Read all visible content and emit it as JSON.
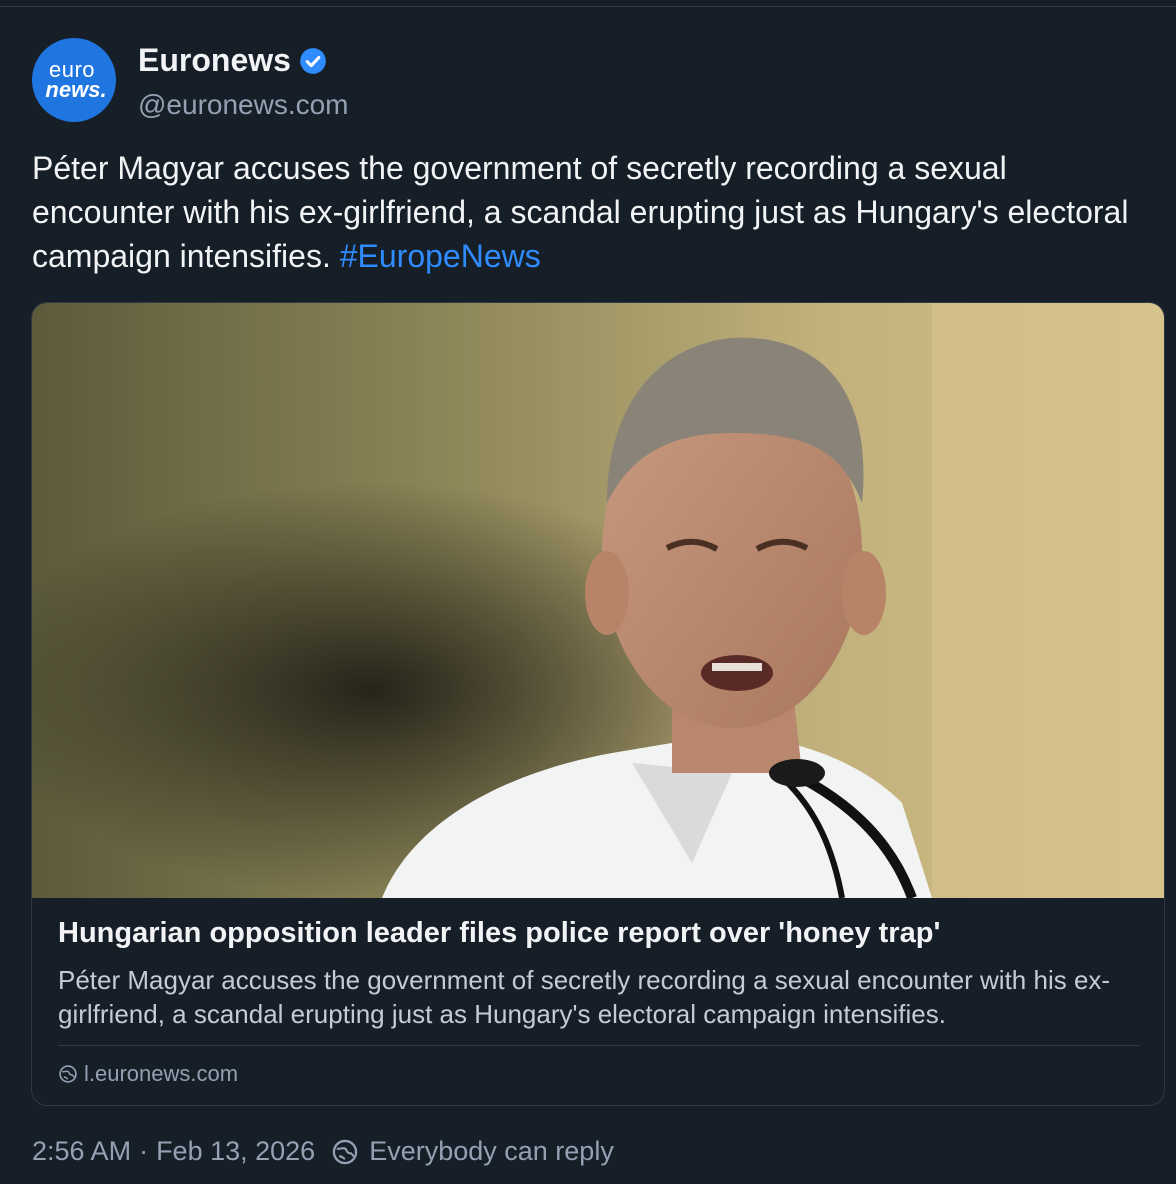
{
  "author": {
    "avatar_line1": "euro",
    "avatar_line2": "news.",
    "display_name": "Euronews",
    "handle": "@euronews.com",
    "verified": true
  },
  "post": {
    "text": "Péter Magyar accuses the government of secretly recording a sexual encounter with his ex-girlfriend, a scandal erupting just as Hungary's electoral campaign intensifies. ",
    "hashtag": "#EuropeNews"
  },
  "link_card": {
    "title": "Hungarian opposition leader files police report over 'honey trap'",
    "description": "Péter Magyar accuses the government of secretly recording a sexual encounter with his ex-girlfriend, a scandal erupting just as Hungary's electoral campaign intensifies.",
    "domain": "l.euronews.com"
  },
  "footer": {
    "time": "2:56 AM",
    "separator": "·",
    "date": "Feb 13, 2026",
    "reply_setting": "Everybody can reply"
  },
  "colors": {
    "background": "#161e27",
    "accent": "#2f8cff",
    "avatar": "#1f76e0",
    "verified": "#2f8cff"
  },
  "icons": [
    "verified-badge-icon",
    "globe-icon",
    "reply-settings-icon"
  ]
}
